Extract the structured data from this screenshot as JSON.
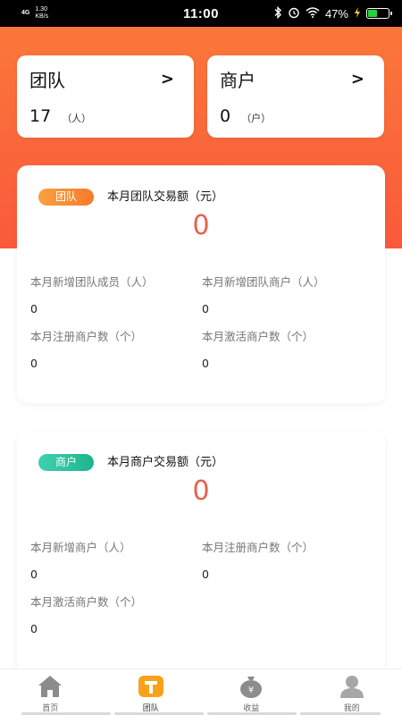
{
  "status_bar": {
    "network": "4G",
    "speed_value": "1.30",
    "speed_unit": "KB/s",
    "time": "11:00",
    "battery_percent": "47%",
    "battery_level": 0.47
  },
  "summary": {
    "team": {
      "title": "团队",
      "arrow": ">",
      "value": "17",
      "unit": "（人）"
    },
    "merchant": {
      "title": "商户",
      "arrow": ">",
      "value": "0",
      "unit": "（户）"
    }
  },
  "team_card": {
    "tag": "团队",
    "title": "本月团队交易额（元）",
    "amount": "0",
    "metrics": [
      {
        "label": "本月新增团队成员（人）",
        "value": "0"
      },
      {
        "label": "本月新增团队商户（人）",
        "value": "0"
      },
      {
        "label": "本月注册商户数（个）",
        "value": "0"
      },
      {
        "label": "本月激活商户数（个）",
        "value": "0"
      }
    ]
  },
  "merchant_card": {
    "tag": "商户",
    "title": "本月商户交易额（元）",
    "amount": "0",
    "metrics": [
      {
        "label": "本月新增商户（人）",
        "value": "0"
      },
      {
        "label": "本月注册商户数（个）",
        "value": "0"
      },
      {
        "label": "本月激活商户数（个）",
        "value": "0"
      }
    ]
  },
  "nav": {
    "items": [
      {
        "label": "首页",
        "icon": "home-icon"
      },
      {
        "label": "团队",
        "icon": "team-icon"
      },
      {
        "label": "收益",
        "icon": "money-bag-icon"
      },
      {
        "label": "我的",
        "icon": "user-icon"
      }
    ],
    "active_index": 1
  },
  "colors": {
    "brand_orange": "#fa5a3b",
    "amount_red": "#e8604c",
    "team_tag": "#f77b2b",
    "merchant_tag": "#1fb38e",
    "active_nav": "#f7a21b"
  }
}
